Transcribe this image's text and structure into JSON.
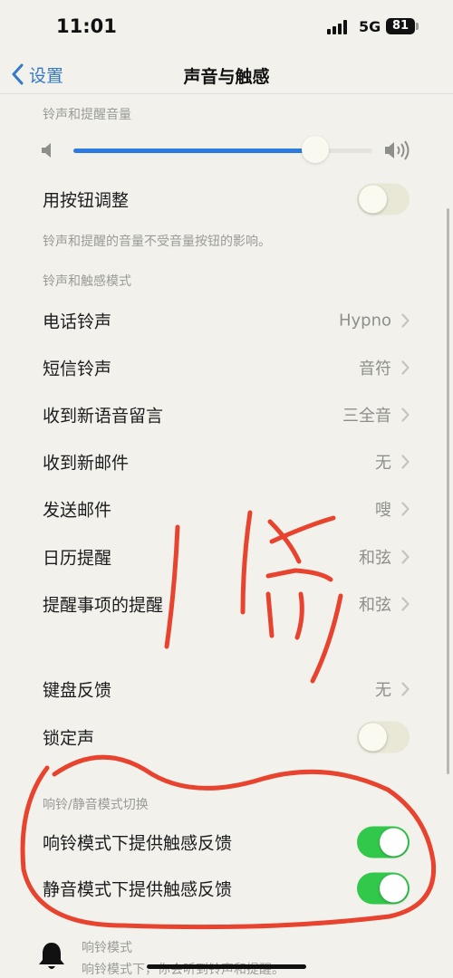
{
  "status_bar": {
    "time": "11:01",
    "network": "5G",
    "battery": "81"
  },
  "nav": {
    "back_label": "设置",
    "title": "声音与触感"
  },
  "ringer_volume": {
    "header": "铃声和提醒音量",
    "level": 0.81
  },
  "adjust_with_buttons": {
    "label": "用按钮调整",
    "on": false,
    "footnote": "铃声和提醒的音量不受音量按钮的影响。"
  },
  "sounds_section": {
    "header": "铃声和触感模式",
    "items": [
      {
        "label": "电话铃声",
        "value": "Hypno"
      },
      {
        "label": "短信铃声",
        "value": "音符"
      },
      {
        "label": "收到新语音留言",
        "value": "三全音"
      },
      {
        "label": "收到新邮件",
        "value": "无"
      },
      {
        "label": "发送邮件",
        "value": "嗖"
      },
      {
        "label": "日历提醒",
        "value": "和弦"
      },
      {
        "label": "提醒事项的提醒",
        "value": "和弦"
      }
    ]
  },
  "keyboard_feedback": {
    "label": "键盘反馈",
    "value": "无"
  },
  "lock_sound": {
    "label": "锁定声",
    "on": false
  },
  "ring_silent": {
    "header": "响铃/静音模式切换",
    "items": [
      {
        "label": "响铃模式下提供触感反馈",
        "on": true
      },
      {
        "label": "静音模式下提供触感反馈",
        "on": true
      }
    ]
  },
  "ring_mode": {
    "title": "响铃模式",
    "description": "响铃模式下，你会听到铃声和提醒。"
  },
  "colors": {
    "accent": "#2d7be0",
    "toggle_on": "#32c84b",
    "annotation": "#e8432e"
  }
}
